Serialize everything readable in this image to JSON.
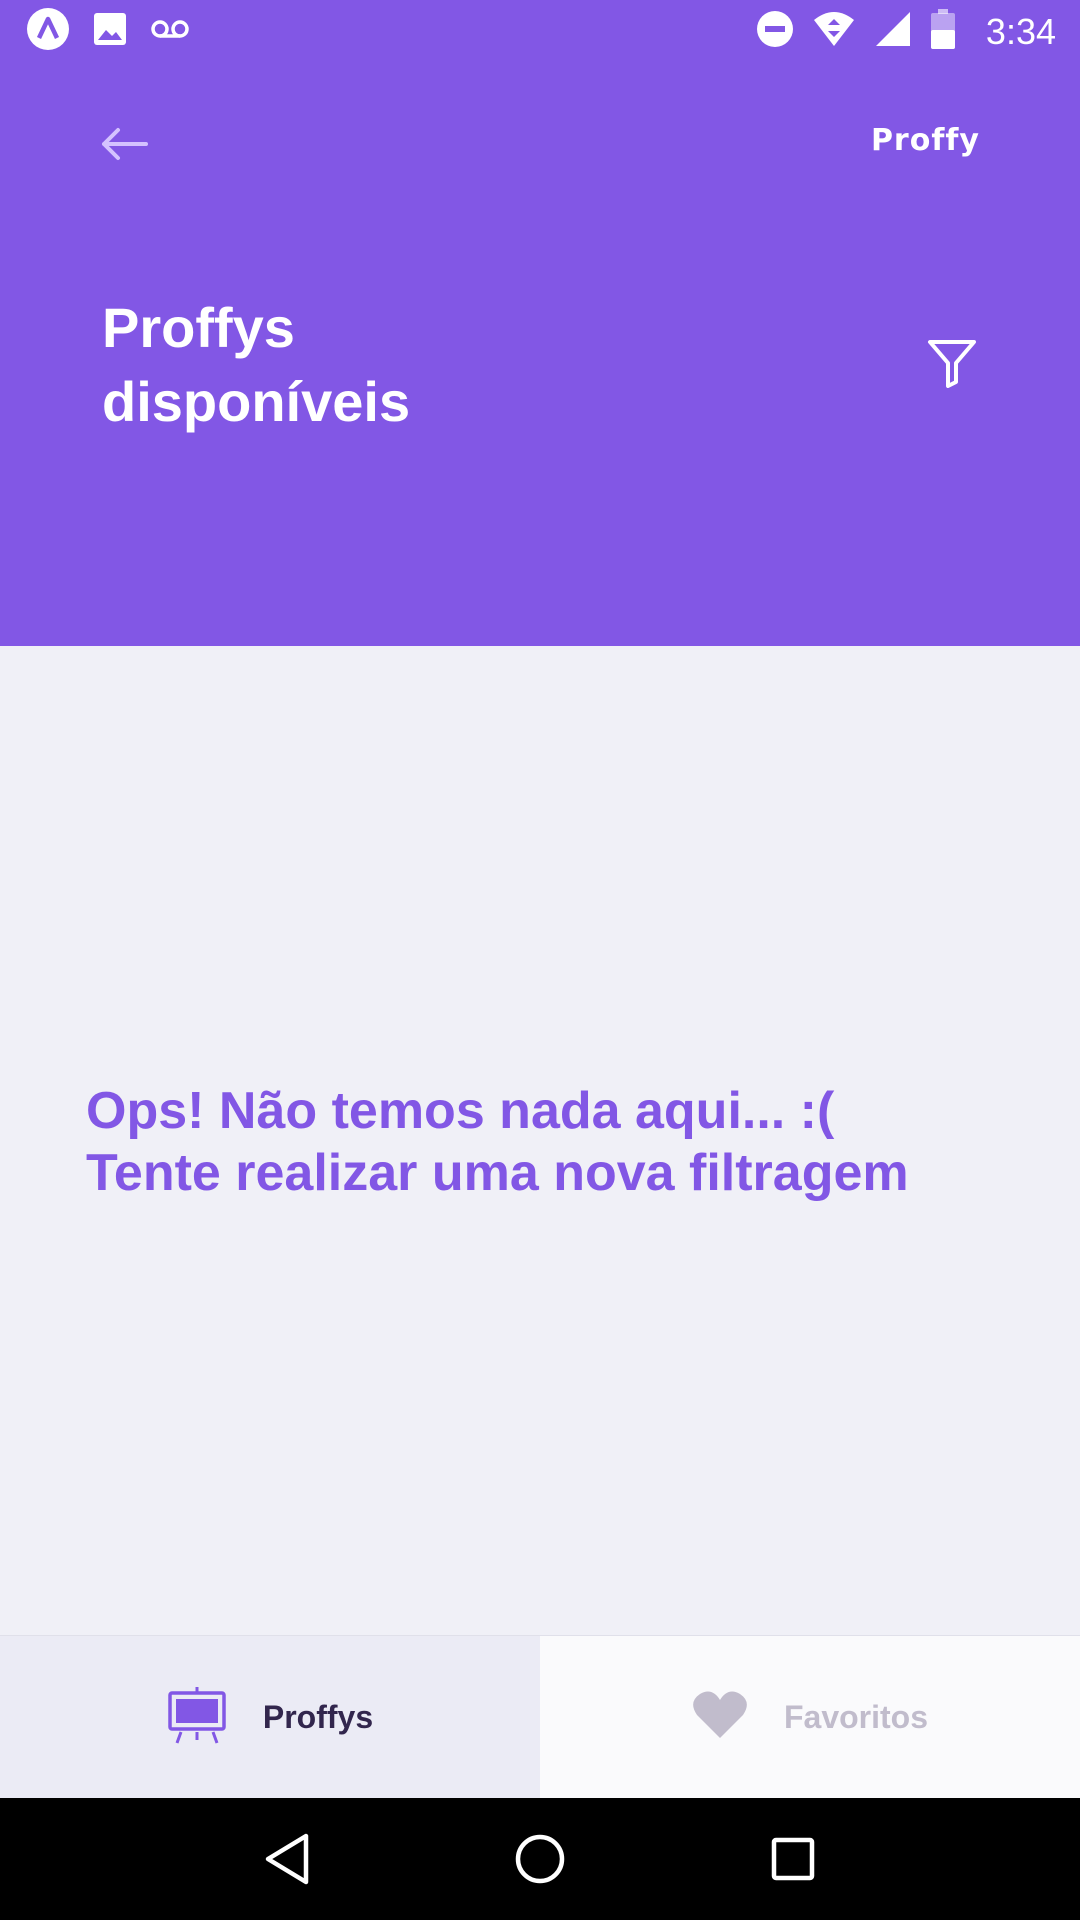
{
  "status_bar": {
    "time": "3:34",
    "icons": [
      "expo-icon",
      "image-icon",
      "voicemail-icon",
      "do-not-disturb-icon",
      "wifi-icon",
      "signal-icon",
      "battery-icon"
    ],
    "battery_level": "44"
  },
  "header": {
    "brand": "Proffy",
    "title": "Proffys\ndisponíveis"
  },
  "main": {
    "empty_message_line1": "Ops! Não temos nada aqui... :(",
    "empty_message_line2": "Tente realizar uma nova filtragem"
  },
  "tabs": [
    {
      "label": "Proffys",
      "icon": "easel-icon",
      "active": true
    },
    {
      "label": "Favoritos",
      "icon": "heart-icon",
      "active": false
    }
  ],
  "colors": {
    "primary": "#8257E5",
    "background": "#F0F0F7",
    "tab_active_text": "#32264D",
    "tab_inactive_text": "#C1BCCC"
  }
}
